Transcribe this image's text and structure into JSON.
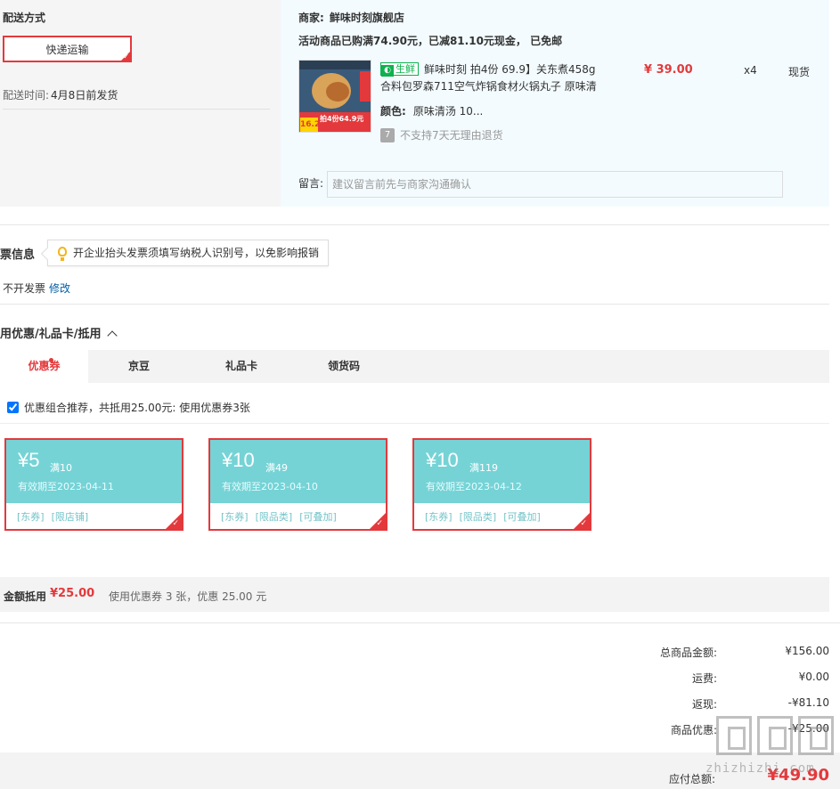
{
  "shipping": {
    "title": "配送方式",
    "method_label": "快递运输",
    "time_label": "配送时间:",
    "time_value": "4月8日前发货"
  },
  "merchant": {
    "label": "商家:",
    "name": "鲜味时刻旗舰店",
    "promo": "活动商品已购满74.90元，已减81.10元现金， 已免邮"
  },
  "product": {
    "image_price": "16.2",
    "image_text": "拍4份64.9元",
    "fresh_tag": "生鲜",
    "title": "鲜味时刻 拍4份 69.9】关东煮458g合料包罗森711空气炸锅食材火锅丸子 原味清",
    "color_label": "颜色:",
    "color_value": "原味清汤 10...",
    "return_icon": "7",
    "return_text": "不支持7天无理由退货",
    "price": "¥ 39.00",
    "qty": "x4",
    "stock": "现货"
  },
  "remark": {
    "label": "留言:",
    "placeholder": "建议留言前先与商家沟通确认"
  },
  "invoice": {
    "title": "票信息",
    "tip": "开企业抬头发票须填写纳税人识别号，以免影响报销",
    "status": "不开发票",
    "edit": "修改"
  },
  "discount": {
    "title": "用优惠/礼品卡/抵用",
    "tabs": [
      {
        "label": "优惠券"
      },
      {
        "label": "京豆"
      },
      {
        "label": "礼品卡"
      },
      {
        "label": "领货码"
      }
    ],
    "combo_text": "优惠组合推荐，共抵用25.00元: 使用优惠券3张",
    "coupons": [
      {
        "amount": "¥5",
        "condition": "满10",
        "expiry": "有效期至2023-04-11",
        "tags": [
          "[东券]",
          "[限店铺]"
        ]
      },
      {
        "amount": "¥10",
        "condition": "满49",
        "expiry": "有效期至2023-04-10",
        "tags": [
          "[东券]",
          "[限品类]",
          "[可叠加]"
        ]
      },
      {
        "amount": "¥10",
        "condition": "满119",
        "expiry": "有效期至2023-04-12",
        "tags": [
          "[东券]",
          "[限品类]",
          "[可叠加]"
        ]
      }
    ],
    "summary_label": "金额抵用",
    "summary_amount": "¥25.00",
    "summary_desc": "使用优惠券 3 张，优惠 25.00 元"
  },
  "totals": {
    "goods_label": "总商品金额:",
    "goods_value": "¥156.00",
    "freight_label": "运费:",
    "freight_value": "¥0.00",
    "cashback_label": "返现:",
    "cashback_value": "-¥81.10",
    "discount_label": "商品优惠:",
    "discount_value": "-¥25.00",
    "pay_label": "应付总额:",
    "pay_value": "¥49.90"
  },
  "watermark": "zhizhizhi.com",
  "colors": {
    "accent": "#e4393c",
    "coupon": "#75d3d6",
    "fresh": "#0fb14f",
    "link": "#005ea7"
  }
}
